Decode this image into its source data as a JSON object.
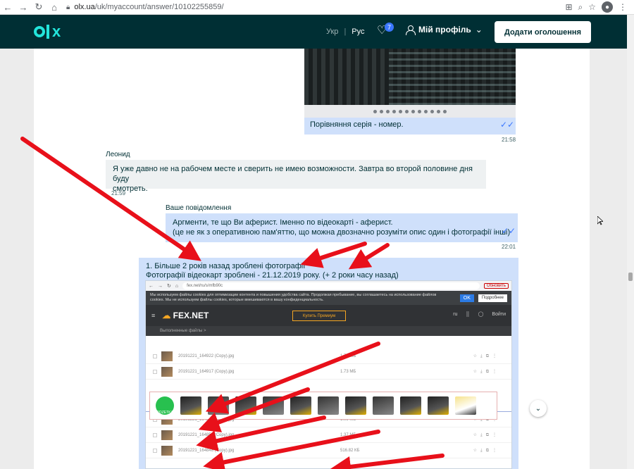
{
  "browser": {
    "url_host": "olx.ua",
    "url_path": "/uk/myaccount/answer/10102255859/"
  },
  "header": {
    "lang_uk": "Укр",
    "lang_ru": "Рус",
    "favorites_count": "7",
    "profile_label": "Мій профіль",
    "add_button": "Додати оголошення"
  },
  "chat": {
    "messages": [
      {
        "text": "Порівняння серія - номер.",
        "time": "21:58"
      },
      {
        "sender": "Леонид",
        "text_line1": "Я уже давно не на рабочем месте и сверить не имею возможности. Завтра во второй половине дня буду",
        "text_line2": "смотреть.",
        "time": "21:59"
      },
      {
        "sender": "Ваше повідомлення",
        "text_line1": "Аргменти, те що Ви аферист. Іменно по відеокарті - аферист.",
        "text_line2": "(це не як з оперативною пам'яттю, що можна двозначно розуміти опис один і фотографії інші)",
        "time": "22:01"
      },
      {
        "line1": "1. Більше 2 років назад зроблені фотографії",
        "line2": "Фотографії відеокарт зроблені - 21.12.2019 року. (+ 2 роки часу назад)"
      }
    ]
  },
  "embedded": {
    "url": "fex.net/ru/s/mfb90c",
    "reload_label": "Обновить",
    "cookie_text_1": "Мы используем файлы cookies для оптимизации контента и повышения удобства сайта. Продолжая пребывание, вы соглашаетесь на использование файлов",
    "cookie_text_2": "cookies. Мы не используем файлы cookies, которые вмешиваются в вашу конфиденциальность.",
    "ok": "OK",
    "more": "Подробнее",
    "logo": "FEX.NET",
    "buy_button": "Купить Премиум",
    "lang": "ru",
    "login": "Войти",
    "crumb": "Выполненные файлы  >",
    "files": [
      {
        "name": "20191221_164922 (Copy).jpg",
        "size": "1.73 МБ"
      },
      {
        "name": "20191221_164917 (Copy).jpg",
        "size": "1.73 МБ"
      },
      {
        "name": "20191221_164858 (Copy).jpg",
        "size": "1.09 МБ"
      },
      {
        "name": "20191221_164853 (Copy).jpg",
        "size": "1.37 МБ"
      },
      {
        "name": "20191221_164848 (Copy).jpg",
        "size": "516.82 КБ"
      }
    ],
    "ad_brand": "ROZETKA"
  }
}
